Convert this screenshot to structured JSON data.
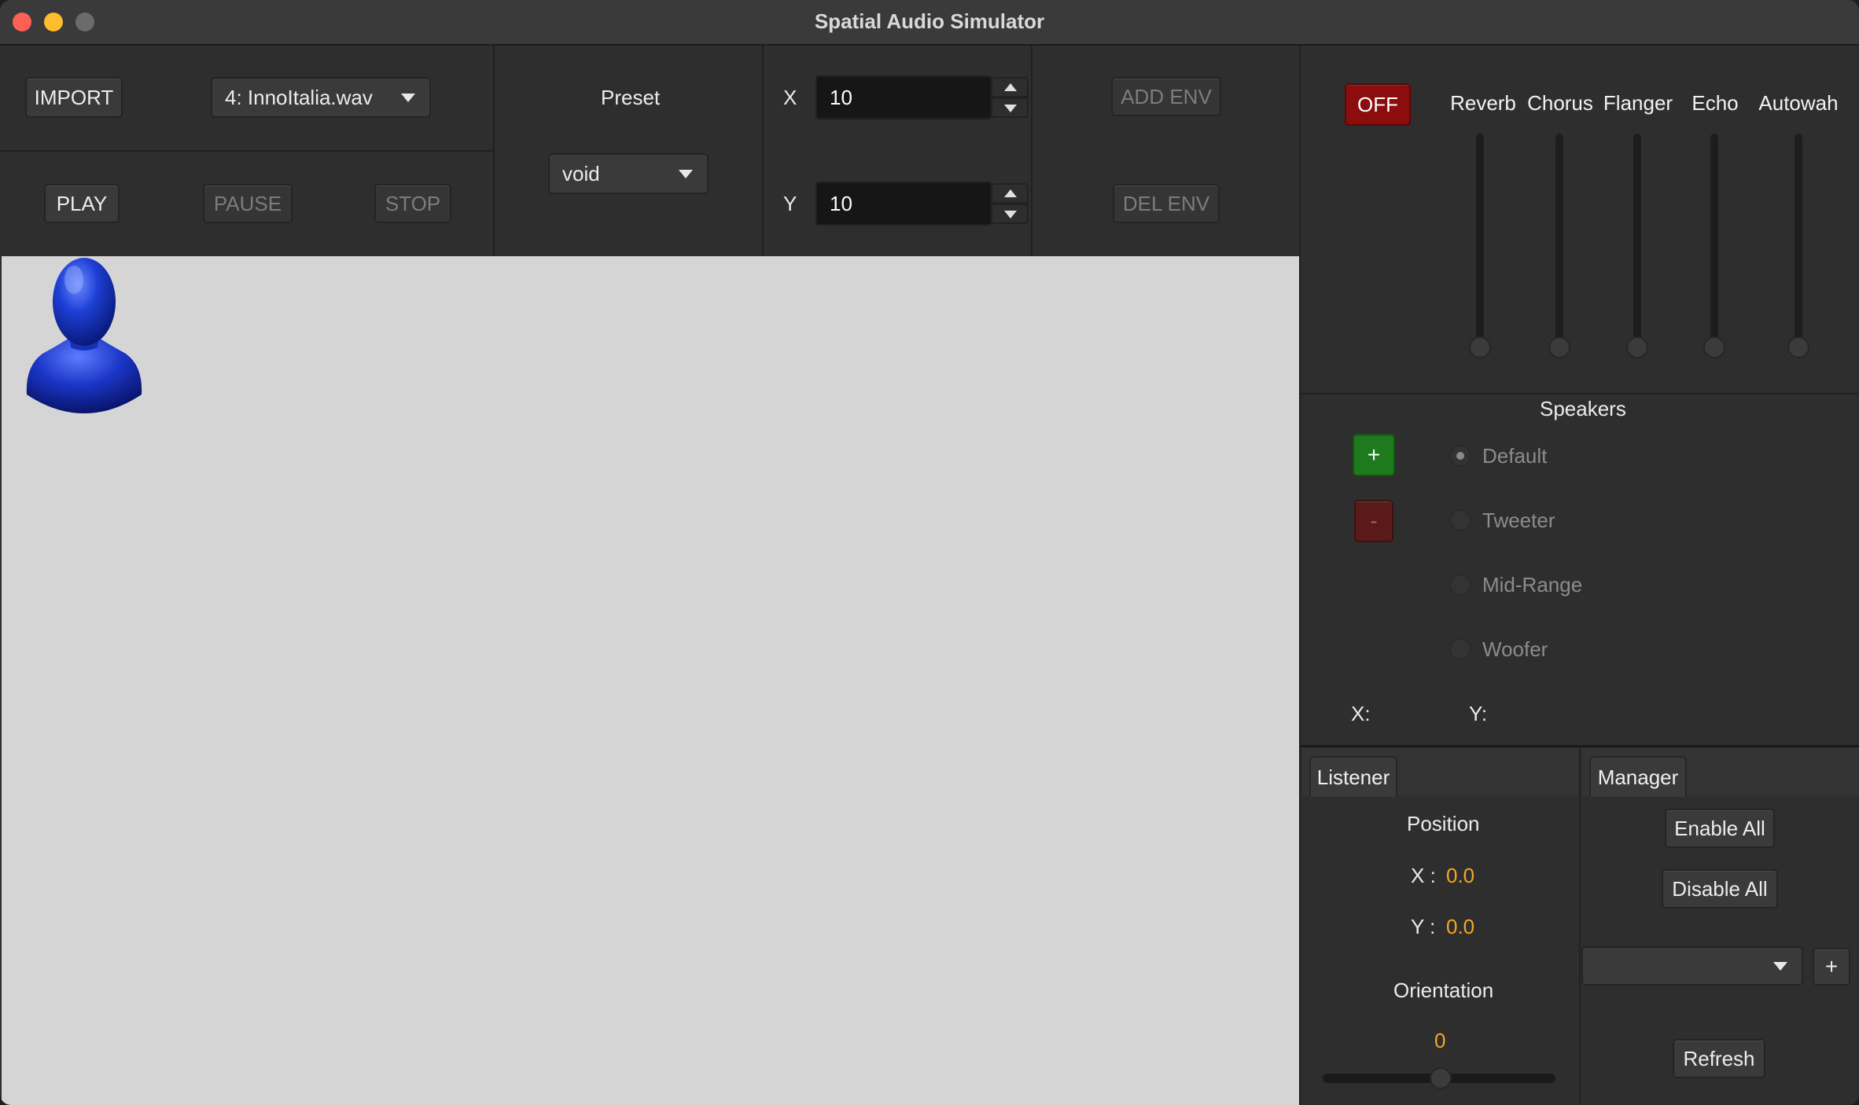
{
  "window": {
    "title": "Spatial Audio Simulator"
  },
  "toolbar": {
    "import_label": "IMPORT",
    "track_selected": "4: InnoItalia.wav",
    "play_label": "PLAY",
    "pause_label": "PAUSE",
    "stop_label": "STOP",
    "preset_label": "Preset",
    "preset_selected": "void",
    "x_label": "X",
    "x_value": "10",
    "y_label": "Y",
    "y_value": "10",
    "add_env_label": "ADD ENV",
    "del_env_label": "DEL ENV"
  },
  "effects": {
    "power_label": "OFF",
    "power_color": "#8b0d0d",
    "sliders": [
      {
        "label": "Reverb",
        "level": 0
      },
      {
        "label": "Chorus",
        "level": 0
      },
      {
        "label": "Flanger",
        "level": 0
      },
      {
        "label": "Echo",
        "level": 0
      },
      {
        "label": "Autowah",
        "level": 0
      }
    ]
  },
  "speakers": {
    "title": "Speakers",
    "add_label": "+",
    "remove_label": "-",
    "add_color": "#1d7a1d",
    "remove_color": "#5a1a1a",
    "options": [
      {
        "label": "Default",
        "selected": true
      },
      {
        "label": "Tweeter",
        "selected": false
      },
      {
        "label": "Mid-Range",
        "selected": false
      },
      {
        "label": "Woofer",
        "selected": false
      }
    ],
    "x_label": "X:",
    "y_label": "Y:"
  },
  "tabs": {
    "listener_label": "Listener",
    "manager_label": "Manager"
  },
  "listener": {
    "position_label": "Position",
    "x_label": "X :",
    "x_value": "0.0",
    "y_label": "Y :",
    "y_value": "0.0",
    "orientation_label": "Orientation",
    "orientation_value": "0",
    "value_color": "#f5a623"
  },
  "manager": {
    "enable_all_label": "Enable All",
    "disable_all_label": "Disable All",
    "combo_selected": "",
    "add_label": "+",
    "refresh_label": "Refresh"
  },
  "canvas": {
    "listener_icon": "person-bust-icon"
  }
}
